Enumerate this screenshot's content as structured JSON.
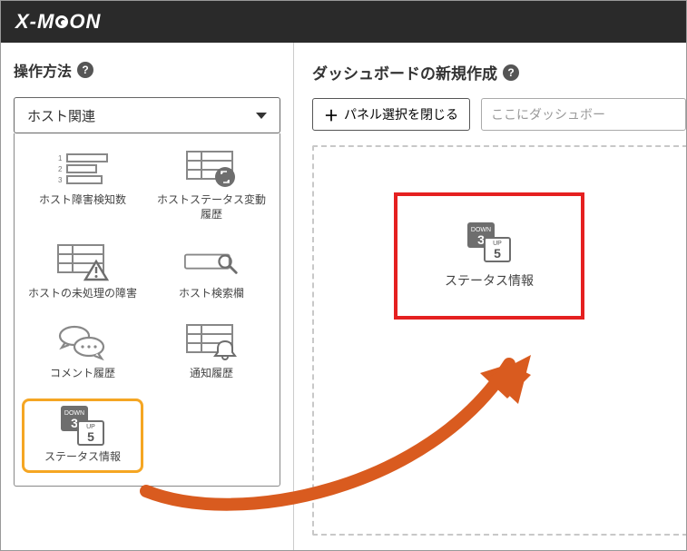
{
  "brand": "X-MOON",
  "sidebar": {
    "title": "操作方法",
    "dropdown": "ホスト関連",
    "widgets": [
      {
        "label": "ホスト障害検知数"
      },
      {
        "label": "ホストステータス変動履歴"
      },
      {
        "label": "ホストの未処理の障害"
      },
      {
        "label": "ホスト検索欄"
      },
      {
        "label": "コメント履歴"
      },
      {
        "label": "通知履歴"
      },
      {
        "label": "ステータス情報"
      }
    ],
    "status_icon": {
      "down_label": "DOWN",
      "down_value": "3",
      "up_label": "UP",
      "up_value": "5"
    }
  },
  "main": {
    "title": "ダッシュボードの新規作成",
    "close_panel_btn": "パネル選択を閉じる",
    "name_placeholder": "ここにダッシュボー",
    "dropped_label": "ステータス情報"
  }
}
